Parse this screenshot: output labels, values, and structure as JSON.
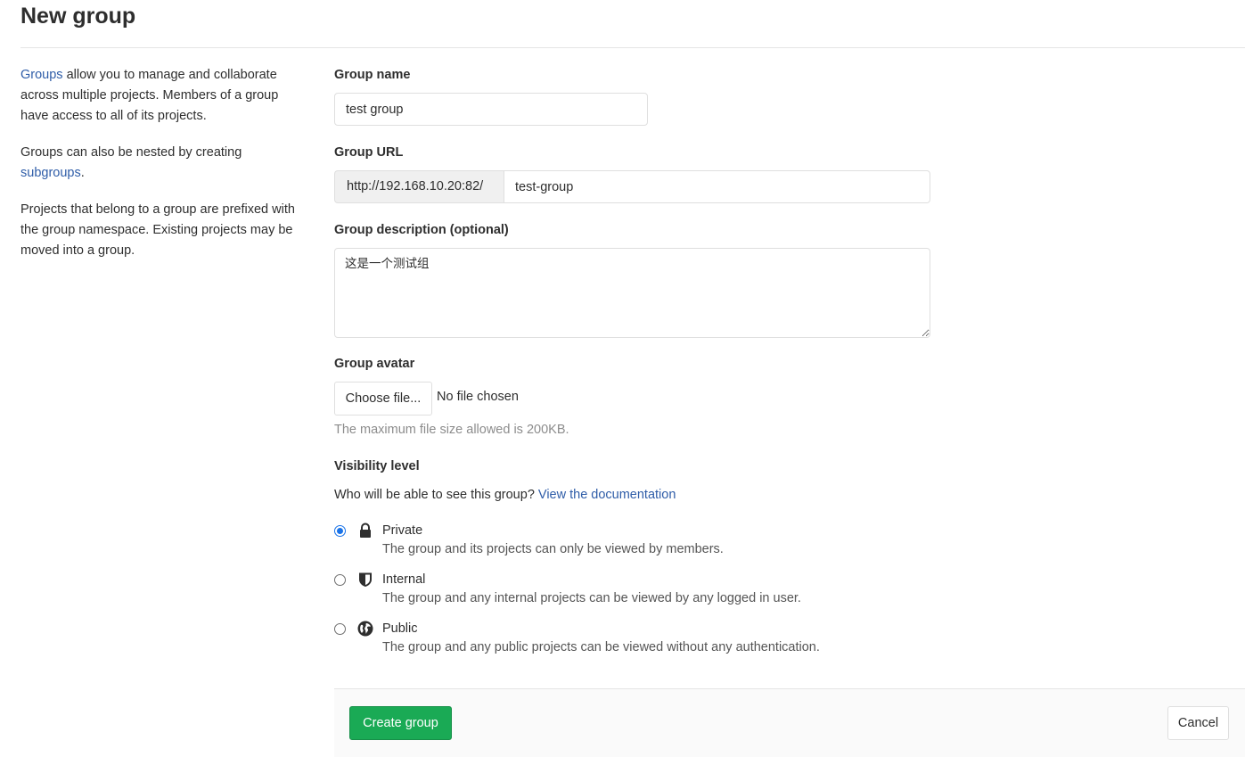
{
  "page": {
    "title": "New group"
  },
  "sidebar": {
    "p1_link": "Groups",
    "p1_text": " allow you to manage and collaborate across multiple projects. Members of a group have access to all of its projects.",
    "p2_text": "Groups can also be nested by creating ",
    "p2_link": "subgroups",
    "p2_end": ".",
    "p3_text": "Projects that belong to a group are prefixed with the group namespace. Existing projects may be moved into a group."
  },
  "form": {
    "group_name": {
      "label": "Group name",
      "value": "test group"
    },
    "group_url": {
      "label": "Group URL",
      "prefix": "http://192.168.10.20:82/",
      "value": "test-group"
    },
    "description": {
      "label": "Group description (optional)",
      "value": "这是一个测试组"
    },
    "avatar": {
      "label": "Group avatar",
      "button": "Choose file...",
      "status": "No file chosen",
      "help": "The maximum file size allowed is 200KB."
    },
    "visibility": {
      "label": "Visibility level",
      "question": "Who will be able to see this group? ",
      "doc_link": "View the documentation",
      "options": [
        {
          "title": "Private",
          "desc": "The group and its projects can only be viewed by members.",
          "icon": "lock-icon",
          "checked": true
        },
        {
          "title": "Internal",
          "desc": "The group and any internal projects can be viewed by any logged in user.",
          "icon": "shield-icon",
          "checked": false
        },
        {
          "title": "Public",
          "desc": "The group and any public projects can be viewed without any authentication.",
          "icon": "globe-icon",
          "checked": false
        }
      ]
    }
  },
  "actions": {
    "create": "Create group",
    "cancel": "Cancel"
  },
  "colors": {
    "primary_link": "#2f5da8",
    "success": "#1aaa55",
    "radio_checked": "#1a73e8"
  }
}
